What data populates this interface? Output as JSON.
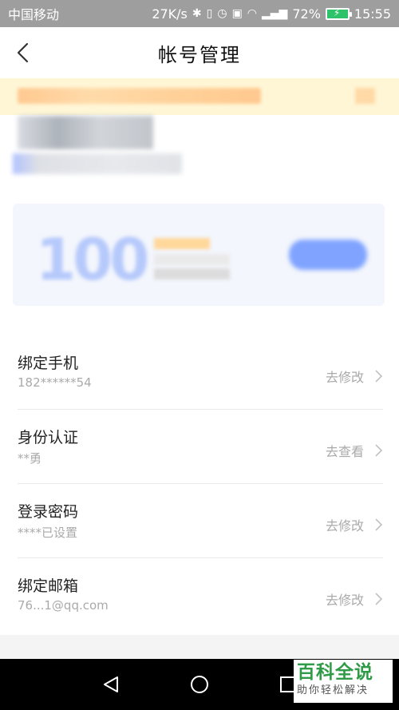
{
  "status_bar": {
    "carrier": "中国移动",
    "speed": "27K/s",
    "battery": "72%",
    "time": "15:55"
  },
  "header": {
    "title": "帐号管理"
  },
  "vip": {
    "number": "100"
  },
  "rows": [
    {
      "label": "绑定手机",
      "value": "182******54",
      "action": "去修改"
    },
    {
      "label": "身份认证",
      "value": "**勇",
      "action": "去查看"
    },
    {
      "label": "登录密码",
      "value": "****已设置",
      "action": "去修改"
    },
    {
      "label": "绑定邮箱",
      "value": "76...1@qq.com",
      "action": "去修改"
    }
  ],
  "watermark": {
    "title": "百科全说",
    "subtitle": "助你轻松解决"
  },
  "colors": {
    "accent_blue": "#7fa3ff",
    "notice_bg": "#fff6d6",
    "watermark_green": "#2f9b47"
  }
}
